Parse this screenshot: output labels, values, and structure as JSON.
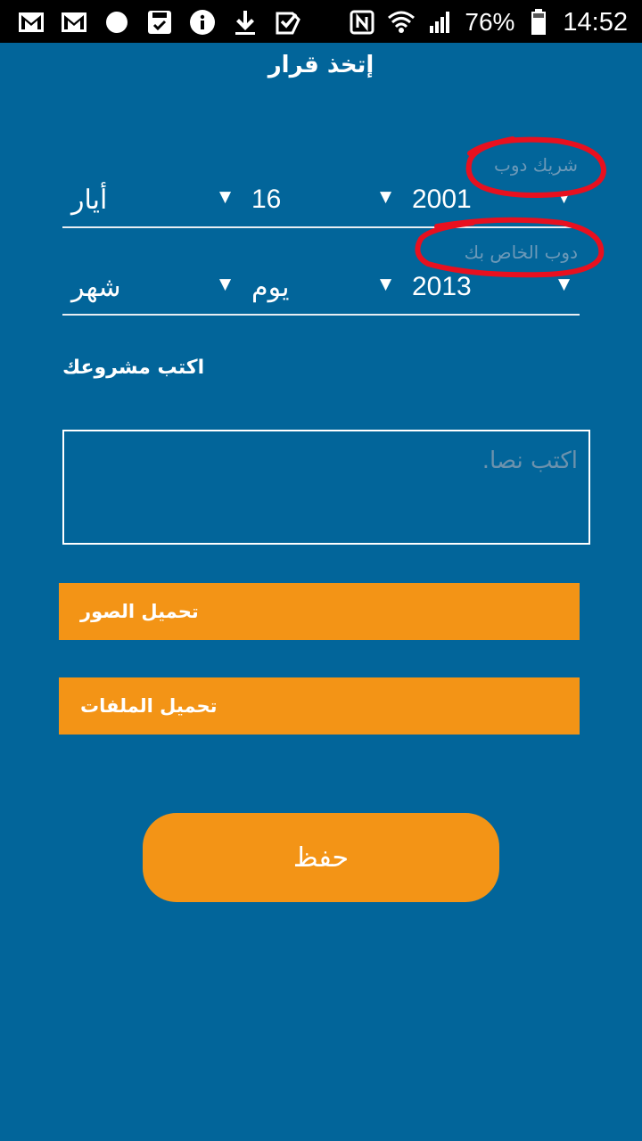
{
  "status_bar": {
    "battery": "76%",
    "time": "14:52",
    "left_icons": [
      "gmail-icon",
      "gmail-icon",
      "circle-icon",
      "save-icon",
      "info-icon",
      "download-icon",
      "check-box-icon"
    ],
    "right_icons": [
      "nfc-icon",
      "wifi-icon",
      "signal-icon",
      "battery-icon"
    ]
  },
  "header": {
    "title": "إتخذ قرار"
  },
  "partner_date": {
    "hint": "شريك دوب",
    "month": "أيار",
    "day": "16",
    "year": "2001"
  },
  "own_date": {
    "hint": "دوب الخاص بك",
    "month": "شهر",
    "day": "يوم",
    "year": "2013"
  },
  "project": {
    "label": "اكتب مشروعك",
    "placeholder": "اكتب  نصا."
  },
  "buttons": {
    "upload_photos": "تحميل الصور",
    "upload_files": "تحميل الملفات",
    "save": "حفظ"
  },
  "colors": {
    "background": "#02659a",
    "accent": "#f39416",
    "annotation": "#e8101f"
  }
}
